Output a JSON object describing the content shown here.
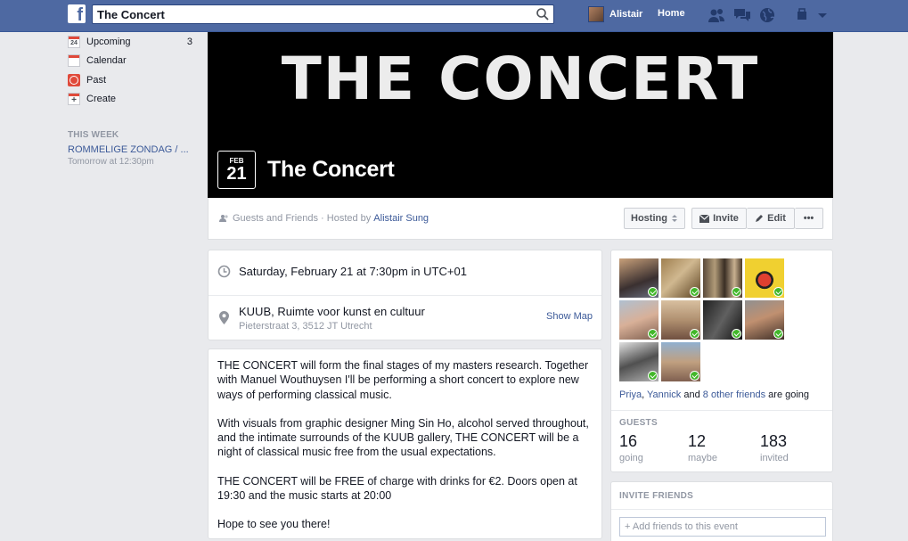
{
  "topbar": {
    "logo": "f",
    "search_value": "The Concert",
    "user_name": "Alistair",
    "home_label": "Home"
  },
  "leftnav": {
    "items": [
      {
        "label": "Upcoming",
        "count": "3",
        "icon_text": "24"
      },
      {
        "label": "Calendar",
        "count": ""
      },
      {
        "label": "Past",
        "count": ""
      },
      {
        "label": "Create",
        "count": ""
      }
    ],
    "this_week_heading": "THIS WEEK",
    "week_event": "ROMMELIGE ZONDAG / ...",
    "week_event_time": "Tomorrow at 12:30pm"
  },
  "cover": {
    "banner_text": "THE CONCERT",
    "month": "FEB",
    "day": "21",
    "title": "The Concert"
  },
  "infobar": {
    "privacy": "Guests and Friends · Hosted by",
    "host": "Alistair Sung",
    "hosting_label": "Hosting",
    "invite_label": "Invite",
    "edit_label": "Edit",
    "more_label": "•••"
  },
  "details": {
    "when": "Saturday, February 21 at 7:30pm in UTC+01",
    "place_name": "KUUB, Ruimte voor kunst en cultuur",
    "place_address": "Pieterstraat 3, 3512 JT Utrecht",
    "show_map": "Show Map"
  },
  "description": {
    "p1": "THE CONCERT will form the final stages of my masters research. Together with Manuel Wouthuysen I'll be performing a short concert to explore new ways of performing classical music.",
    "p2": "With visuals from graphic designer Ming Sin Ho, alcohol served throughout, and the intimate surrounds of the KUUB gallery, THE CONCERT will be a night of classical music free from the usual expectations.",
    "p3": "THE CONCERT will be FREE of charge with drinks for €2. Doors open at 19:30 and the music starts at 20:00",
    "p4": "Hope to see you there!"
  },
  "guests": {
    "going_name1": "Priya",
    "going_sep": ", ",
    "going_name2": "Yannick",
    "going_and": " and ",
    "going_others": "8 other friends",
    "going_suffix": " are going",
    "heading": "GUESTS",
    "stats": [
      {
        "num": "16",
        "label": "going"
      },
      {
        "num": "12",
        "label": "maybe"
      },
      {
        "num": "183",
        "label": "invited"
      }
    ]
  },
  "invite": {
    "heading": "INVITE FRIENDS",
    "placeholder": "+ Add friends to this event"
  },
  "colors": {
    "brand": "#4e69a2",
    "link": "#3b5998",
    "going_check": "#42b72a"
  }
}
